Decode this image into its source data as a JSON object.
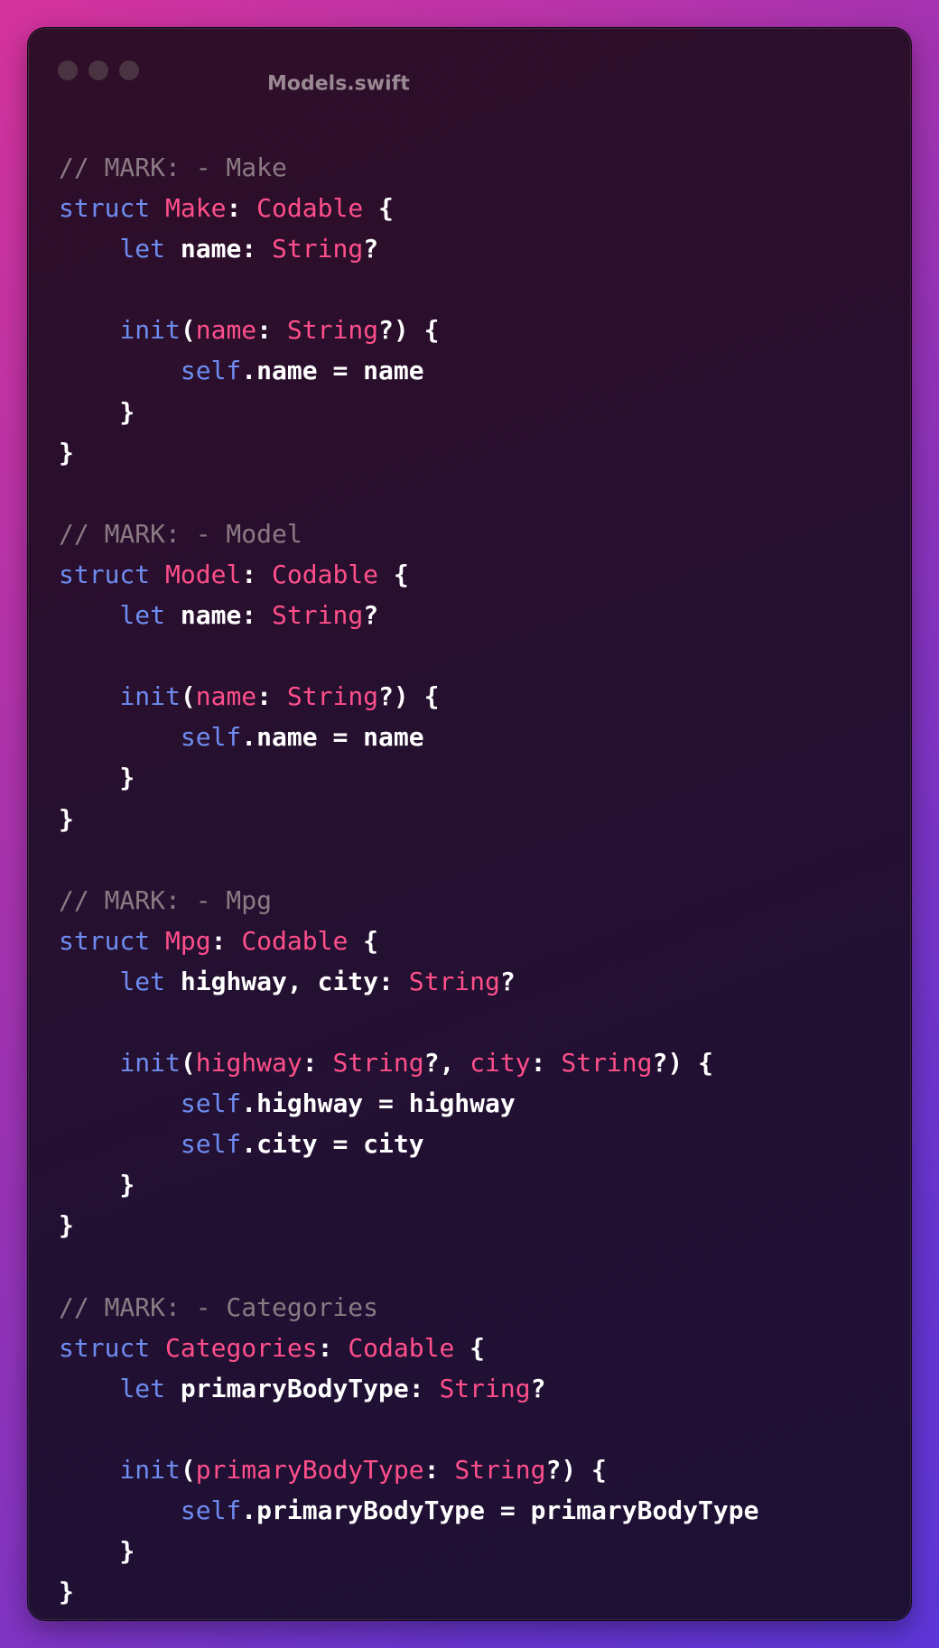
{
  "window": {
    "title": "Models.swift",
    "controls": [
      "close-icon",
      "minimize-icon",
      "zoom-icon"
    ]
  },
  "colors": {
    "comment": "#8a7a83",
    "keyword": "#6e8cf0",
    "type": "#ff4f8b",
    "plain": "#ffffff"
  },
  "code": {
    "lines": [
      [
        {
          "k": "comment",
          "t": "// MARK: - Make"
        }
      ],
      [
        {
          "k": "keyword",
          "t": "struct"
        },
        {
          "k": "plain",
          "t": " "
        },
        {
          "k": "type",
          "t": "Make"
        },
        {
          "k": "plain",
          "t": ": "
        },
        {
          "k": "type",
          "t": "Codable"
        },
        {
          "k": "plain",
          "t": " {"
        }
      ],
      [
        {
          "k": "plain",
          "t": "    "
        },
        {
          "k": "keyword",
          "t": "let"
        },
        {
          "k": "plain",
          "t": " name: "
        },
        {
          "k": "type",
          "t": "String"
        },
        {
          "k": "plain",
          "t": "?"
        }
      ],
      [],
      [
        {
          "k": "plain",
          "t": "    "
        },
        {
          "k": "keyword",
          "t": "init"
        },
        {
          "k": "plain",
          "t": "("
        },
        {
          "k": "param",
          "t": "name"
        },
        {
          "k": "plain",
          "t": ": "
        },
        {
          "k": "type",
          "t": "String"
        },
        {
          "k": "plain",
          "t": "?) {"
        }
      ],
      [
        {
          "k": "plain",
          "t": "        "
        },
        {
          "k": "keyword",
          "t": "self"
        },
        {
          "k": "plain",
          "t": ".name = name"
        }
      ],
      [
        {
          "k": "plain",
          "t": "    }"
        }
      ],
      [
        {
          "k": "plain",
          "t": "}"
        }
      ],
      [],
      [
        {
          "k": "comment",
          "t": "// MARK: - Model"
        }
      ],
      [
        {
          "k": "keyword",
          "t": "struct"
        },
        {
          "k": "plain",
          "t": " "
        },
        {
          "k": "type",
          "t": "Model"
        },
        {
          "k": "plain",
          "t": ": "
        },
        {
          "k": "type",
          "t": "Codable"
        },
        {
          "k": "plain",
          "t": " {"
        }
      ],
      [
        {
          "k": "plain",
          "t": "    "
        },
        {
          "k": "keyword",
          "t": "let"
        },
        {
          "k": "plain",
          "t": " name: "
        },
        {
          "k": "type",
          "t": "String"
        },
        {
          "k": "plain",
          "t": "?"
        }
      ],
      [],
      [
        {
          "k": "plain",
          "t": "    "
        },
        {
          "k": "keyword",
          "t": "init"
        },
        {
          "k": "plain",
          "t": "("
        },
        {
          "k": "param",
          "t": "name"
        },
        {
          "k": "plain",
          "t": ": "
        },
        {
          "k": "type",
          "t": "String"
        },
        {
          "k": "plain",
          "t": "?) {"
        }
      ],
      [
        {
          "k": "plain",
          "t": "        "
        },
        {
          "k": "keyword",
          "t": "self"
        },
        {
          "k": "plain",
          "t": ".name = name"
        }
      ],
      [
        {
          "k": "plain",
          "t": "    }"
        }
      ],
      [
        {
          "k": "plain",
          "t": "}"
        }
      ],
      [],
      [
        {
          "k": "comment",
          "t": "// MARK: - Mpg"
        }
      ],
      [
        {
          "k": "keyword",
          "t": "struct"
        },
        {
          "k": "plain",
          "t": " "
        },
        {
          "k": "type",
          "t": "Mpg"
        },
        {
          "k": "plain",
          "t": ": "
        },
        {
          "k": "type",
          "t": "Codable"
        },
        {
          "k": "plain",
          "t": " {"
        }
      ],
      [
        {
          "k": "plain",
          "t": "    "
        },
        {
          "k": "keyword",
          "t": "let"
        },
        {
          "k": "plain",
          "t": " highway, city: "
        },
        {
          "k": "type",
          "t": "String"
        },
        {
          "k": "plain",
          "t": "?"
        }
      ],
      [],
      [
        {
          "k": "plain",
          "t": "    "
        },
        {
          "k": "keyword",
          "t": "init"
        },
        {
          "k": "plain",
          "t": "("
        },
        {
          "k": "param",
          "t": "highway"
        },
        {
          "k": "plain",
          "t": ": "
        },
        {
          "k": "type",
          "t": "String"
        },
        {
          "k": "plain",
          "t": "?, "
        },
        {
          "k": "param",
          "t": "city"
        },
        {
          "k": "plain",
          "t": ": "
        },
        {
          "k": "type",
          "t": "String"
        },
        {
          "k": "plain",
          "t": "?) {"
        }
      ],
      [
        {
          "k": "plain",
          "t": "        "
        },
        {
          "k": "keyword",
          "t": "self"
        },
        {
          "k": "plain",
          "t": ".highway = highway"
        }
      ],
      [
        {
          "k": "plain",
          "t": "        "
        },
        {
          "k": "keyword",
          "t": "self"
        },
        {
          "k": "plain",
          "t": ".city = city"
        }
      ],
      [
        {
          "k": "plain",
          "t": "    }"
        }
      ],
      [
        {
          "k": "plain",
          "t": "}"
        }
      ],
      [],
      [
        {
          "k": "comment",
          "t": "// MARK: - Categories"
        }
      ],
      [
        {
          "k": "keyword",
          "t": "struct"
        },
        {
          "k": "plain",
          "t": " "
        },
        {
          "k": "type",
          "t": "Categories"
        },
        {
          "k": "plain",
          "t": ": "
        },
        {
          "k": "type",
          "t": "Codable"
        },
        {
          "k": "plain",
          "t": " {"
        }
      ],
      [
        {
          "k": "plain",
          "t": "    "
        },
        {
          "k": "keyword",
          "t": "let"
        },
        {
          "k": "plain",
          "t": " primaryBodyType: "
        },
        {
          "k": "type",
          "t": "String"
        },
        {
          "k": "plain",
          "t": "?"
        }
      ],
      [],
      [
        {
          "k": "plain",
          "t": "    "
        },
        {
          "k": "keyword",
          "t": "init"
        },
        {
          "k": "plain",
          "t": "("
        },
        {
          "k": "param",
          "t": "primaryBodyType"
        },
        {
          "k": "plain",
          "t": ": "
        },
        {
          "k": "type",
          "t": "String"
        },
        {
          "k": "plain",
          "t": "?) {"
        }
      ],
      [
        {
          "k": "plain",
          "t": "        "
        },
        {
          "k": "keyword",
          "t": "self"
        },
        {
          "k": "plain",
          "t": ".primaryBodyType = primaryBodyType"
        }
      ],
      [
        {
          "k": "plain",
          "t": "    }"
        }
      ],
      [
        {
          "k": "plain",
          "t": "}"
        }
      ]
    ]
  }
}
